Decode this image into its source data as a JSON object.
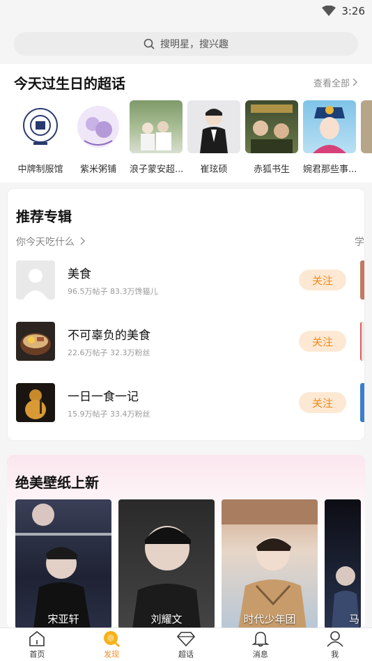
{
  "status": {
    "time": "3:26",
    "icons": [
      "wifi-icon"
    ]
  },
  "search": {
    "placeholder": "搜明星，搜兴趣"
  },
  "birthday": {
    "title": "今天过生日的超话",
    "see_all": "查看全部",
    "items": [
      {
        "name": "中牌制服馆",
        "image": "emblem-logo"
      },
      {
        "name": "紫米粥铺",
        "image": "purple-logo"
      },
      {
        "name": "浪子蒙安超...",
        "image": "photo"
      },
      {
        "name": "崔玹硕",
        "image": "photo"
      },
      {
        "name": "赤狐书生",
        "image": "photo"
      },
      {
        "name": "婉君那些事...",
        "image": "illustration"
      }
    ]
  },
  "albums": {
    "title": "推荐专辑",
    "subtitle": "你今天吃什么",
    "next_subtitle": "学",
    "follow_label": "关注",
    "items": [
      {
        "name": "美食",
        "meta": "96.5万帖子 83.3万馋猫儿"
      },
      {
        "name": "不可辜负的美食",
        "meta": "22.6万帖子 32.3万粉丝"
      },
      {
        "name": "一日一食一记",
        "meta": "15.9万帖子 33.4万粉丝"
      }
    ]
  },
  "wallpaper": {
    "title": "绝美壁纸上新",
    "items": [
      {
        "name": "宋亚轩"
      },
      {
        "name": "刘耀文"
      },
      {
        "name": "时代少年团"
      },
      {
        "name": "马"
      }
    ]
  },
  "tabs": [
    {
      "label": "首页",
      "icon": "home-icon",
      "active": false
    },
    {
      "label": "发现",
      "icon": "discover-icon",
      "active": true
    },
    {
      "label": "超话",
      "icon": "diamond-icon",
      "active": false
    },
    {
      "label": "消息",
      "icon": "bell-icon",
      "active": false
    },
    {
      "label": "我",
      "icon": "person-icon",
      "active": false
    }
  ],
  "colors": {
    "accent": "#f08a1c",
    "follow_bg": "#fde9d3"
  }
}
